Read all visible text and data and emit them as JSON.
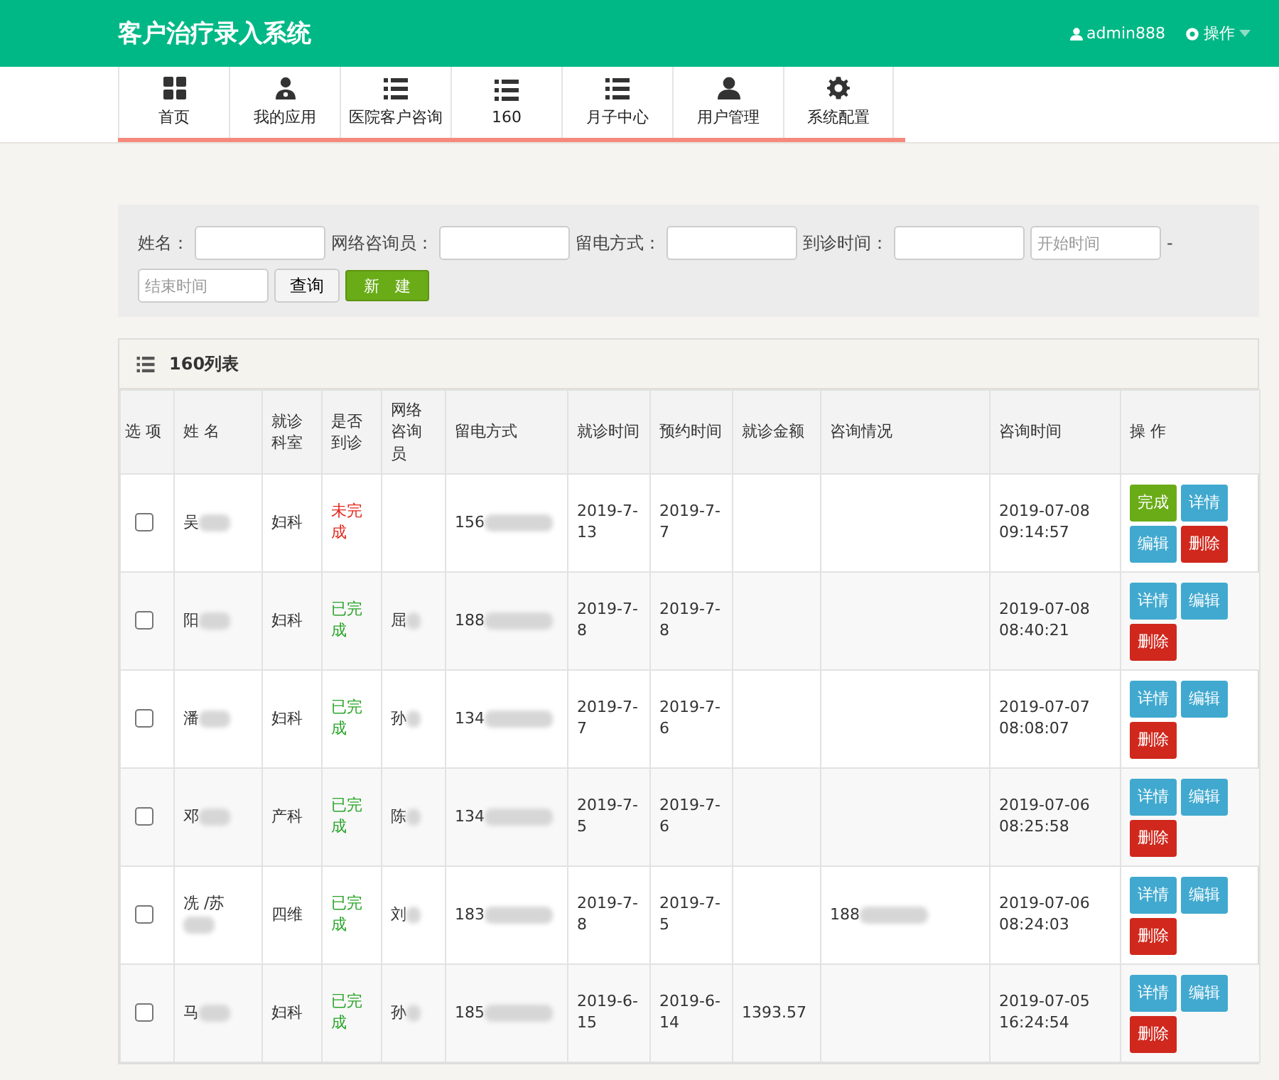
{
  "header": {
    "title": "客户治疗录入系统",
    "user": "admin888",
    "menu": "操作"
  },
  "nav": [
    {
      "label": "首页",
      "kind": "grid"
    },
    {
      "label": "我的应用",
      "kind": "doctor"
    },
    {
      "label": "医院客户咨询",
      "kind": "list"
    },
    {
      "label": "160",
      "kind": "list"
    },
    {
      "label": "月子中心",
      "kind": "list"
    },
    {
      "label": "用户管理",
      "kind": "user"
    },
    {
      "label": "系统配置",
      "kind": "gear"
    }
  ],
  "filters": {
    "fields": [
      {
        "label": "姓名："
      },
      {
        "label": "网络咨询员："
      },
      {
        "label": "留电方式："
      },
      {
        "label": "到诊时间："
      }
    ],
    "start_placeholder": "开始时间",
    "dash": "-",
    "end_placeholder": "结束时间",
    "query_button": "查询",
    "new_button": "新　建"
  },
  "table": {
    "title": "160列表",
    "columns": [
      "选 项",
      "姓 名",
      "就诊科室",
      "是否到诊",
      "网络咨询员",
      "留电方式",
      "就诊时间",
      "预约时间",
      "就诊金额",
      "咨询情况",
      "咨询时间",
      "操 作"
    ],
    "rows": [
      {
        "checked": false,
        "name": "吴",
        "dept": "妇科",
        "arrived": false,
        "status": "未完成",
        "consultant": "",
        "phone": "156",
        "visit": "2019-7-13",
        "appointment": "2019-7-7",
        "amount": "",
        "info": "",
        "time": "2019-07-08 09:14:57",
        "actions": [
          {
            "kind": "complete",
            "label": "完成"
          },
          {
            "kind": "detail",
            "label": "详情"
          },
          {
            "kind": "edit",
            "label": "编辑"
          },
          {
            "kind": "delete",
            "label": "删除"
          }
        ]
      },
      {
        "checked": false,
        "name": "阳",
        "dept": "妇科",
        "arrived": true,
        "status": "已完成",
        "consultant": "屈",
        "phone": "188",
        "visit": "2019-7-8",
        "appointment": "2019-7-8",
        "amount": "",
        "info": "",
        "time": "2019-07-08 08:40:21",
        "actions": [
          {
            "kind": "detail",
            "label": "详情"
          },
          {
            "kind": "edit",
            "label": "编辑"
          },
          {
            "kind": "delete",
            "label": "删除"
          }
        ]
      },
      {
        "checked": false,
        "name": "潘",
        "dept": "妇科",
        "arrived": true,
        "status": "已完成",
        "consultant": "孙",
        "phone": "134",
        "visit": "2019-7-7",
        "appointment": "2019-7-6",
        "amount": "",
        "info": "",
        "time": "2019-07-07 08:08:07",
        "actions": [
          {
            "kind": "detail",
            "label": "详情"
          },
          {
            "kind": "edit",
            "label": "编辑"
          },
          {
            "kind": "delete",
            "label": "删除"
          }
        ]
      },
      {
        "checked": false,
        "name": "邓",
        "dept": "产科",
        "arrived": true,
        "status": "已完成",
        "consultant": "陈",
        "phone": "134",
        "visit": "2019-7-5",
        "appointment": "2019-7-6",
        "amount": "",
        "info": "",
        "time": "2019-07-06 08:25:58",
        "actions": [
          {
            "kind": "detail",
            "label": "详情"
          },
          {
            "kind": "edit",
            "label": "编辑"
          },
          {
            "kind": "delete",
            "label": "删除"
          }
        ]
      },
      {
        "checked": false,
        "name": "冼 /苏",
        "dept": "四维",
        "arrived": true,
        "status": "已完成",
        "consultant": "刘",
        "phone": "183",
        "visit": "2019-7-8",
        "appointment": "2019-7-5",
        "amount": "",
        "info": "188",
        "time": "2019-07-06 08:24:03",
        "actions": [
          {
            "kind": "detail",
            "label": "详情"
          },
          {
            "kind": "edit",
            "label": "编辑"
          },
          {
            "kind": "delete",
            "label": "删除"
          }
        ]
      },
      {
        "checked": false,
        "name": "马",
        "dept": "妇科",
        "arrived": true,
        "status": "已完成",
        "consultant": "孙",
        "phone": "185",
        "visit": "2019-6-15",
        "appointment": "2019-6-14",
        "amount": "1393.57",
        "info": "",
        "time": "2019-07-05 16:24:54",
        "actions": [
          {
            "kind": "detail",
            "label": "详情"
          },
          {
            "kind": "edit",
            "label": "编辑"
          },
          {
            "kind": "delete",
            "label": "删除"
          }
        ]
      }
    ]
  }
}
